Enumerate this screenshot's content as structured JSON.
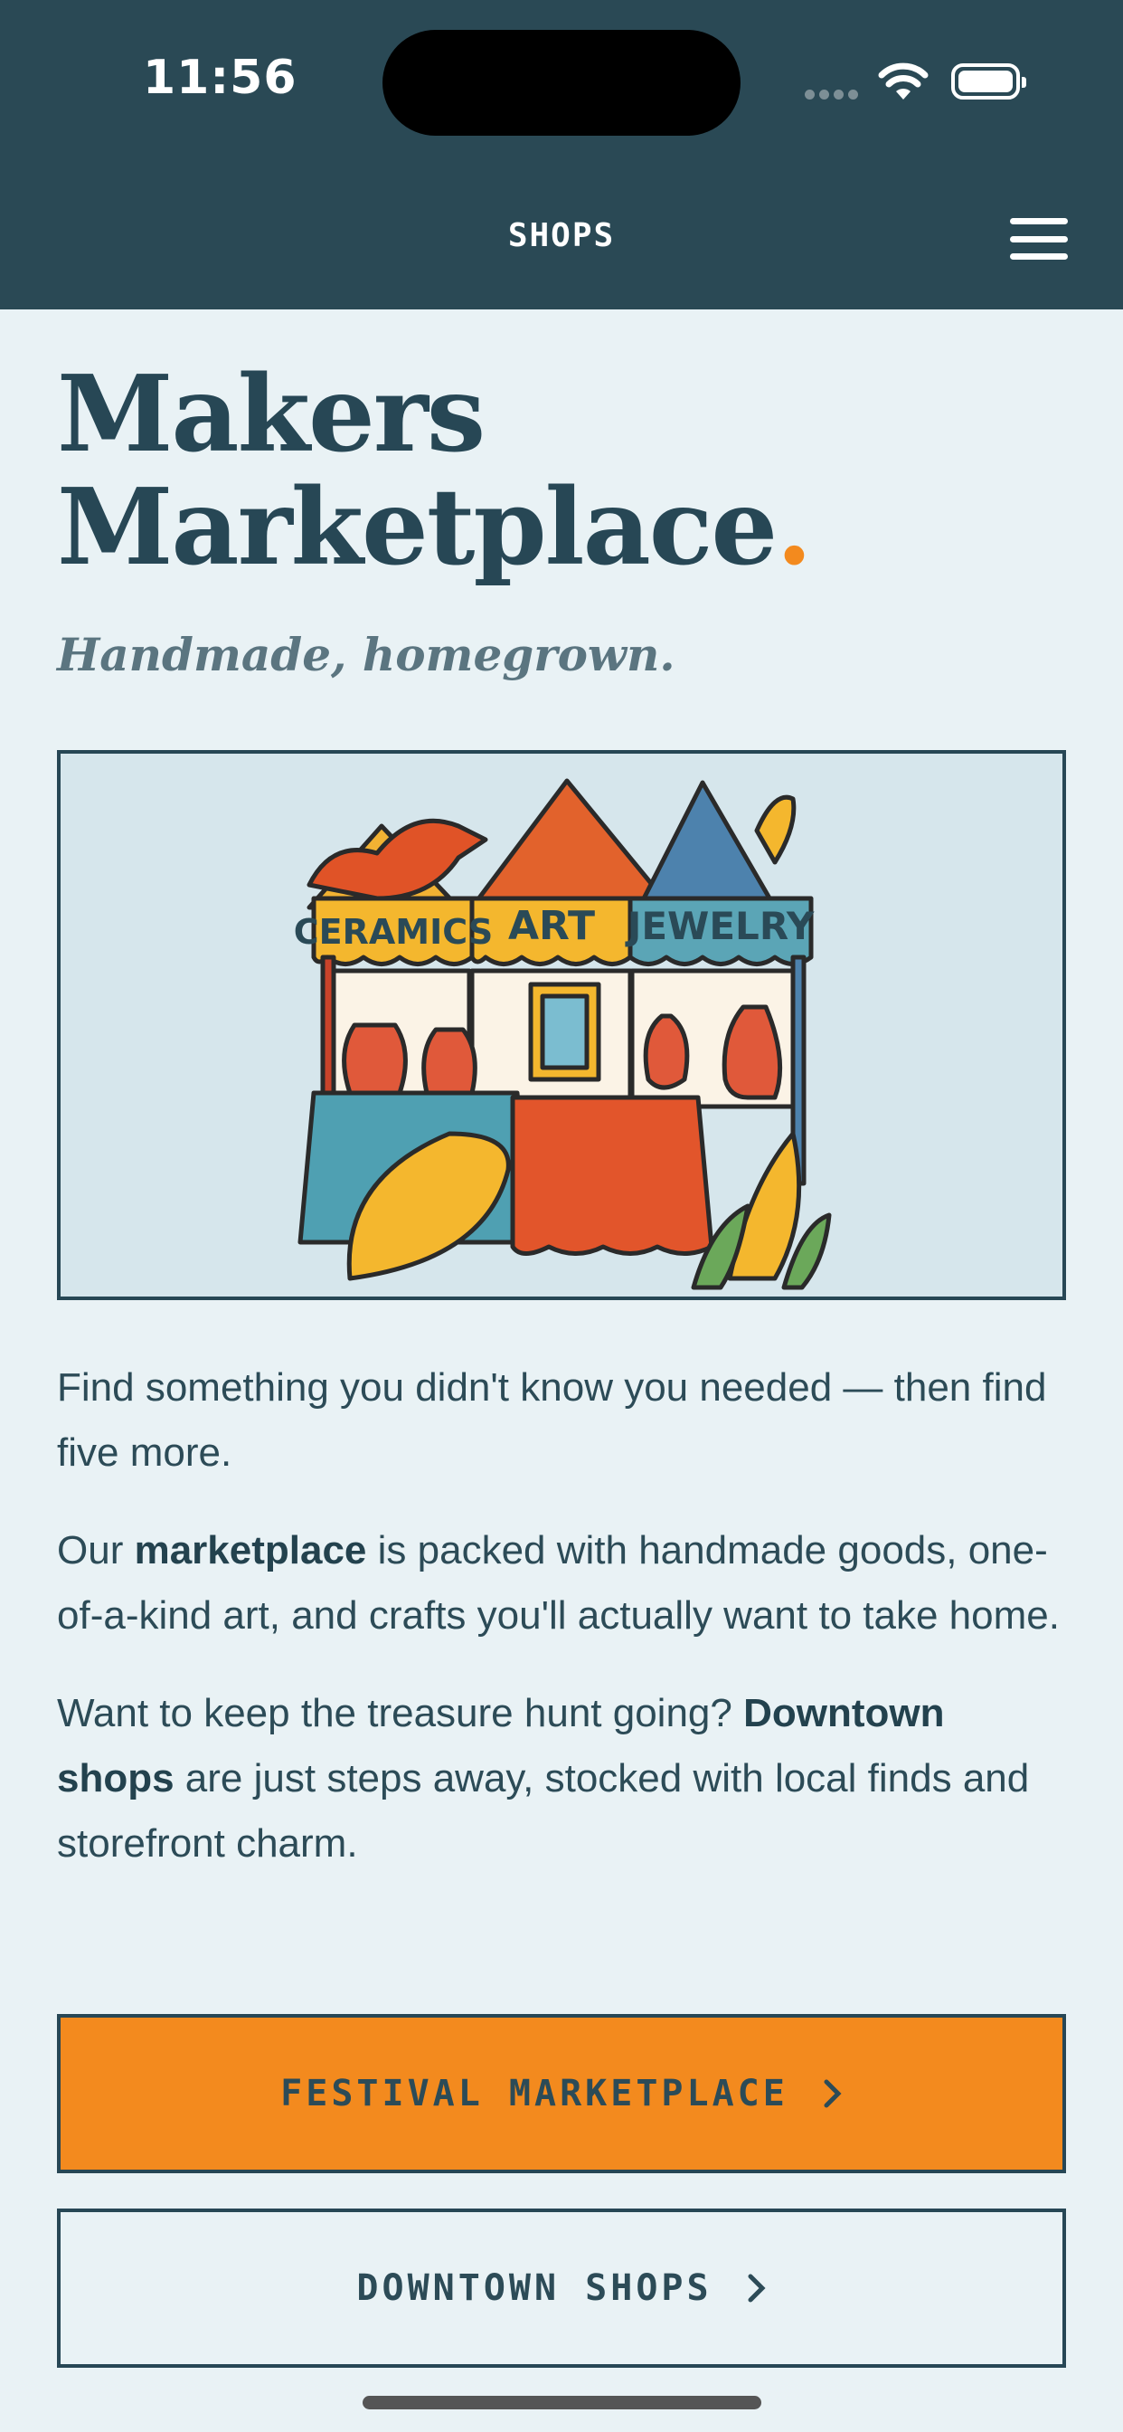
{
  "status_bar": {
    "time": "11:56"
  },
  "nav": {
    "title": "SHOPS",
    "menu_icon": "hamburger-menu-icon"
  },
  "page": {
    "title_line1": "Makers",
    "title_line2": "Marketplace",
    "title_dot": ".",
    "subtitle": "Handmade, homegrown."
  },
  "hero": {
    "stall_labels": [
      "CERAMICS",
      "ART",
      "JEWELRY"
    ]
  },
  "body": {
    "p1": "Find something you didn't know you needed — then find five more.",
    "p2_a": "Our ",
    "p2_bold": "marketplace",
    "p2_b": " is packed with handmade goods, one-of-a-kind art, and crafts you'll actually want to take home.",
    "p3_a": "Want to keep the treasure hunt going? ",
    "p3_bold": "Downtown shops",
    "p3_b": " are just steps away, stocked with local finds and storefront charm."
  },
  "buttons": {
    "primary_label": "FESTIVAL MARKETPLACE",
    "secondary_label": "DOWNTOWN SHOPS"
  },
  "colors": {
    "header_bg": "#2a4955",
    "page_bg": "#e9f2f5",
    "accent_orange": "#f38a1e",
    "text_dark": "#274755"
  }
}
